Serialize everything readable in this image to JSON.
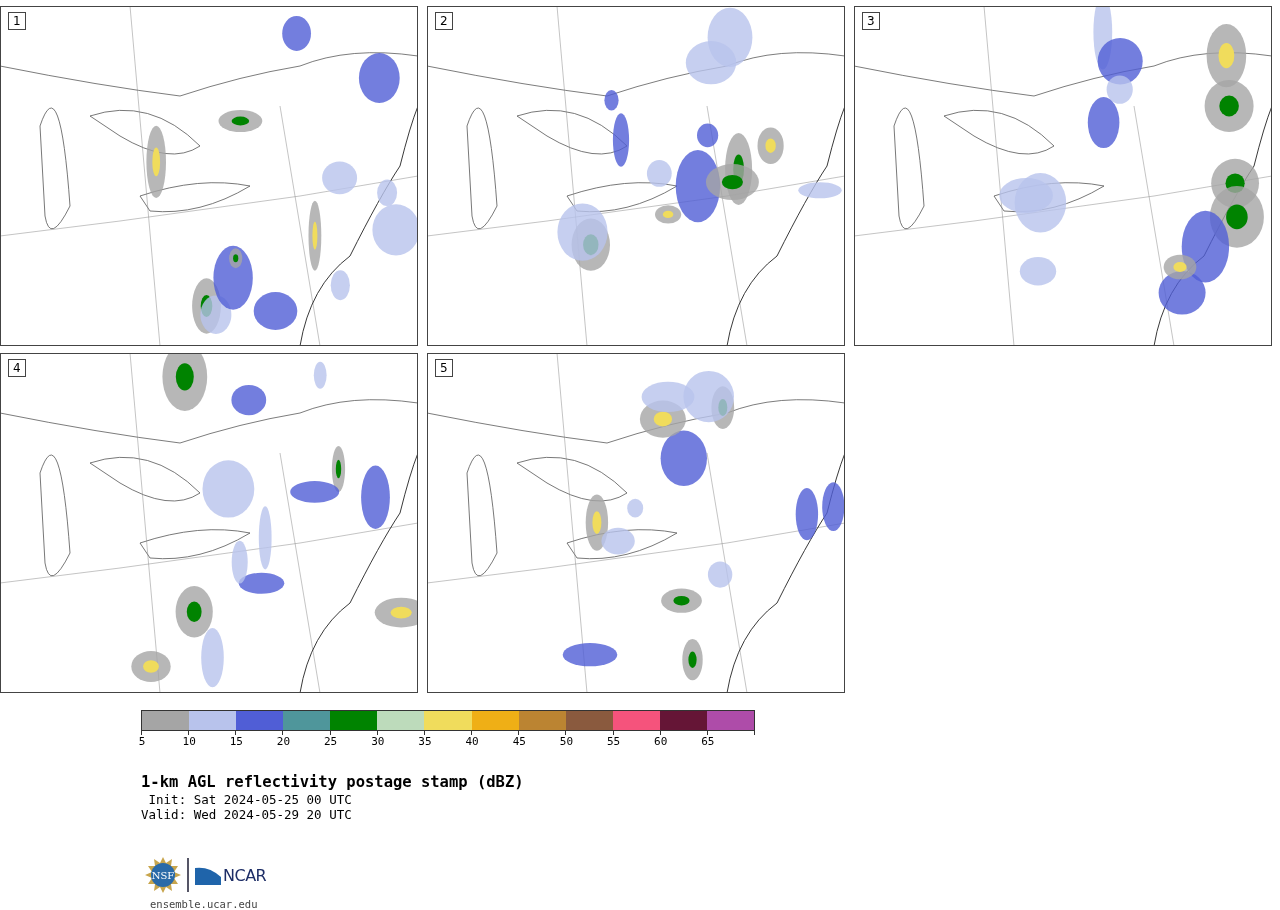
{
  "panels": [
    {
      "label": "1"
    },
    {
      "label": "2"
    },
    {
      "label": "3"
    },
    {
      "label": "4"
    },
    {
      "label": "5"
    }
  ],
  "colorbar": {
    "bins": [
      {
        "label": "5",
        "color": "#a5a5a5"
      },
      {
        "label": "10",
        "color": "#b8c3ec"
      },
      {
        "label": "15",
        "color": "#505ed6"
      },
      {
        "label": "20",
        "color": "#4f969b"
      },
      {
        "label": "25",
        "color": "#008300"
      },
      {
        "label": "30",
        "color": "#bddbbb"
      },
      {
        "label": "35",
        "color": "#f0dc5c"
      },
      {
        "label": "40",
        "color": "#efaf16"
      },
      {
        "label": "45",
        "color": "#bb8432"
      },
      {
        "label": "50",
        "color": "#8a5a3e"
      },
      {
        "label": "55",
        "color": "#f5537c"
      },
      {
        "label": "60",
        "color": "#651536"
      },
      {
        "label": "65",
        "color": "#ae4ca9"
      }
    ]
  },
  "title": "1-km AGL reflectivity postage stamp (dBZ)",
  "init": " Init: Sat 2024-05-25 00 UTC",
  "valid": "Valid: Wed 2024-05-29 20 UTC",
  "logos": {
    "nsf": "NSF",
    "ncar": "NCAR"
  },
  "url": "ensemble.ucar.edu"
}
